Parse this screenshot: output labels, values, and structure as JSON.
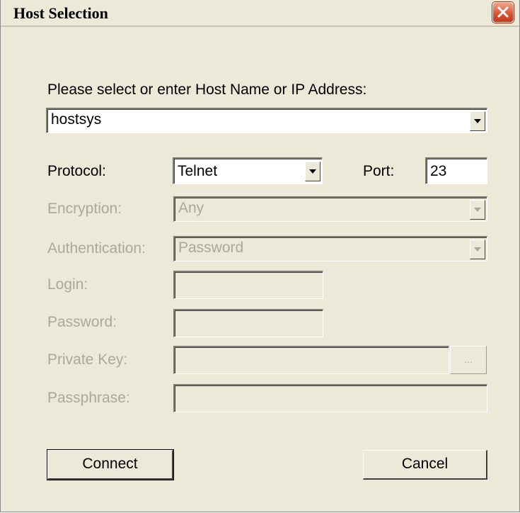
{
  "window": {
    "title": "Host Selection",
    "close_icon": "close-x"
  },
  "prompt": "Please select or enter Host Name or IP Address:",
  "host": {
    "value": "hostsys"
  },
  "protocol": {
    "label": "Protocol:",
    "value": "Telnet"
  },
  "port": {
    "label": "Port:",
    "value": "23"
  },
  "encryption": {
    "label": "Encryption:",
    "value": "Any"
  },
  "authentication": {
    "label": "Authentication:",
    "value": "Password"
  },
  "login": {
    "label": "Login:",
    "value": ""
  },
  "password": {
    "label": "Password:",
    "value": ""
  },
  "private_key": {
    "label": "Private Key:",
    "value": "",
    "browse_label": "..."
  },
  "passphrase": {
    "label": "Passphrase:",
    "value": ""
  },
  "buttons": {
    "connect": "Connect",
    "cancel": "Cancel"
  },
  "colors": {
    "dialog_bg": "#ece9d8",
    "disabled_text": "#aca899",
    "close_red": "#d6502f"
  }
}
